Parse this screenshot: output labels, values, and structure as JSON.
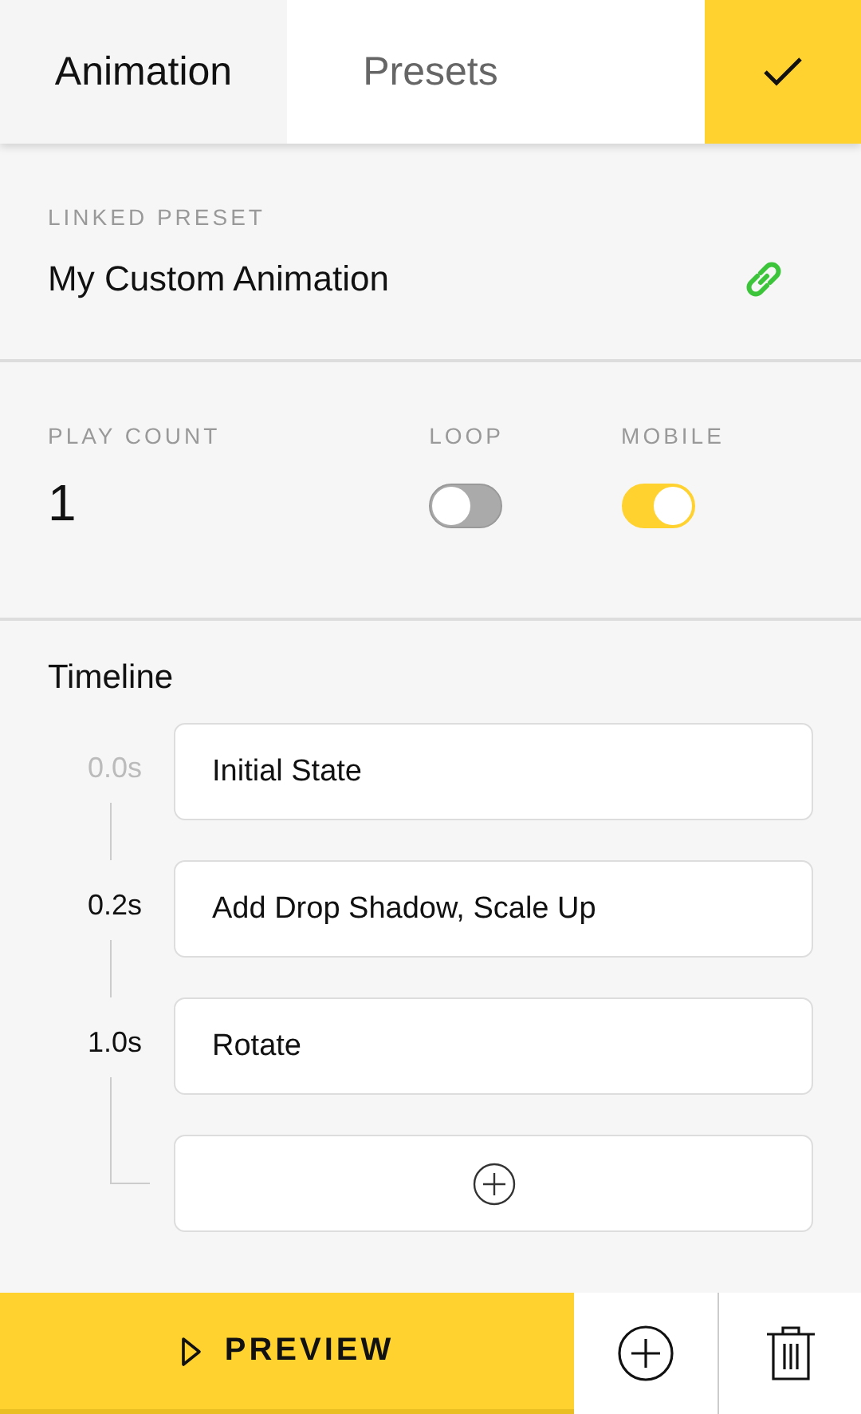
{
  "tabs": [
    {
      "label": "Animation",
      "selected": true
    },
    {
      "label": "Presets",
      "selected": false
    }
  ],
  "linked_preset": {
    "label": "LINKED PRESET",
    "value": "My Custom Animation"
  },
  "settings": {
    "play_count": {
      "label": "PLAY COUNT",
      "value": "1"
    },
    "toggles": [
      {
        "label": "LOOP",
        "on": false
      },
      {
        "label": "MOBILE",
        "on": true
      }
    ]
  },
  "timeline": {
    "title": "Timeline",
    "steps": [
      {
        "time": "0.0s",
        "muted": true,
        "name": "Initial State"
      },
      {
        "time": "0.2s",
        "muted": false,
        "name": "Add Drop Shadow, Scale Up"
      },
      {
        "time": "1.0s",
        "muted": false,
        "name": "Rotate"
      }
    ]
  },
  "footer": {
    "preview": "PREVIEW"
  }
}
